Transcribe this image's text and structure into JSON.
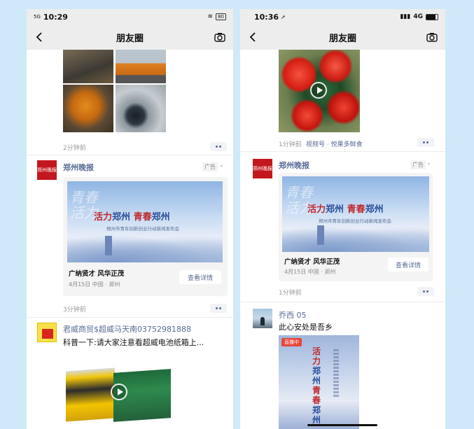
{
  "left": {
    "status": {
      "time": "10:29",
      "signal": "5G",
      "battery": "80"
    },
    "nav": {
      "title": "朋友圈"
    },
    "post1": {
      "time": "2分钟前"
    },
    "ad": {
      "name": "郑州晚报",
      "avatar_text": "郑州晚报",
      "badge": "广告",
      "banner_red1": "活力",
      "banner_blue1": "郑州",
      "banner_red2": "青春",
      "banner_blue2": "郑州",
      "banner_sub": "郑州市青年创新创业行动新闻发布会",
      "banner_wm": "青春活力",
      "slogan": "广纳贤才 风华正茂",
      "meta": "4月15日  中国 · 郑州",
      "button": "查看详情",
      "time": "3分钟前"
    },
    "post3": {
      "name": "君威商贸$超威马天南03752981888",
      "text": "科普一下:请大家注意看超威电池纸箱上..."
    }
  },
  "right": {
    "status": {
      "time": "10:36",
      "network": "4G"
    },
    "nav": {
      "title": "朋友圈"
    },
    "post1": {
      "time": "1分钟前",
      "source": "视频号 · 悦果多鲜食"
    },
    "ad": {
      "name": "郑州晚报",
      "avatar_text": "郑州晚报",
      "badge": "广告",
      "banner_red1": "活力",
      "banner_blue1": "郑州",
      "banner_red2": "青春",
      "banner_blue2": "郑州",
      "banner_sub": "郑州市青年创新创业行动新闻发布会",
      "banner_wm": "青春活力",
      "slogan": "广纳贤才 风华正茂",
      "meta": "4月15日  中国 · 郑州",
      "button": "查看详情",
      "time": "1分钟前"
    },
    "post3": {
      "name": "乔西 05",
      "text": "此心安处是吾乡",
      "live_badge": "直播中",
      "poster_title1": "活力",
      "poster_title2": "郑州",
      "poster_title3": "青春",
      "poster_title4": "郑州"
    }
  },
  "colors": {
    "link": "#576b95",
    "ad_red": "#c3171e",
    "bg": "#cfe9f8"
  }
}
